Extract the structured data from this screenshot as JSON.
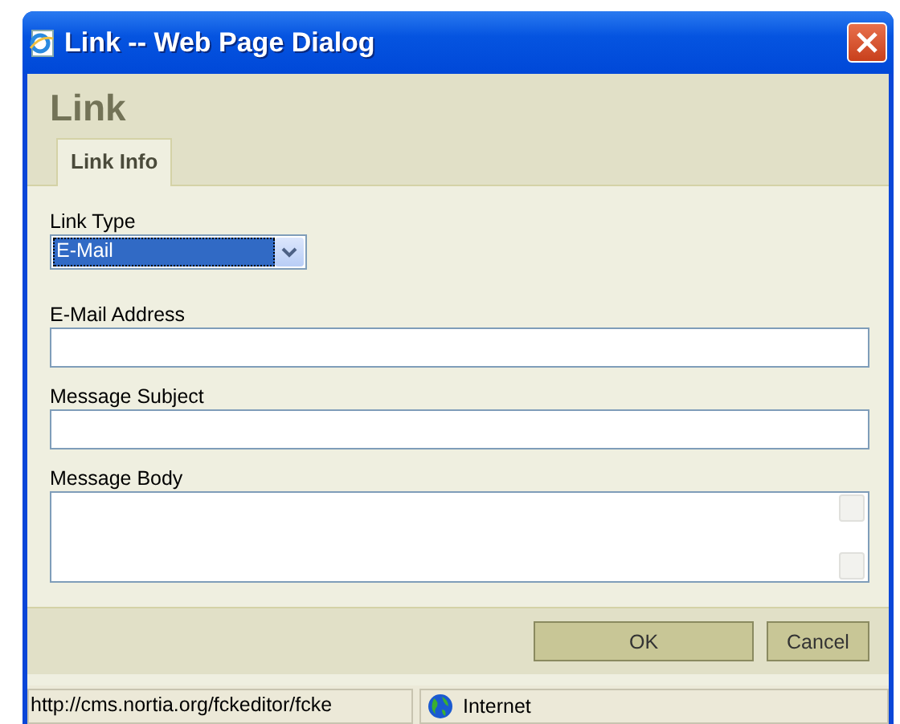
{
  "window": {
    "title": "Link -- Web Page Dialog"
  },
  "heading": "Link",
  "tabs": [
    {
      "label": "Link Info",
      "selected": true
    }
  ],
  "link_type": {
    "label": "Link Type",
    "value": "E-Mail"
  },
  "fields": [
    {
      "label": "E-Mail Address",
      "kind": "input"
    },
    {
      "label": "Message Subject",
      "kind": "input"
    },
    {
      "label": "Message Body",
      "kind": "textarea"
    }
  ],
  "buttons": [
    "OK",
    "Cancel"
  ],
  "status_bar": {
    "url": "http://cms.nortia.org/fckeditor/fcke",
    "zone": "Internet"
  }
}
